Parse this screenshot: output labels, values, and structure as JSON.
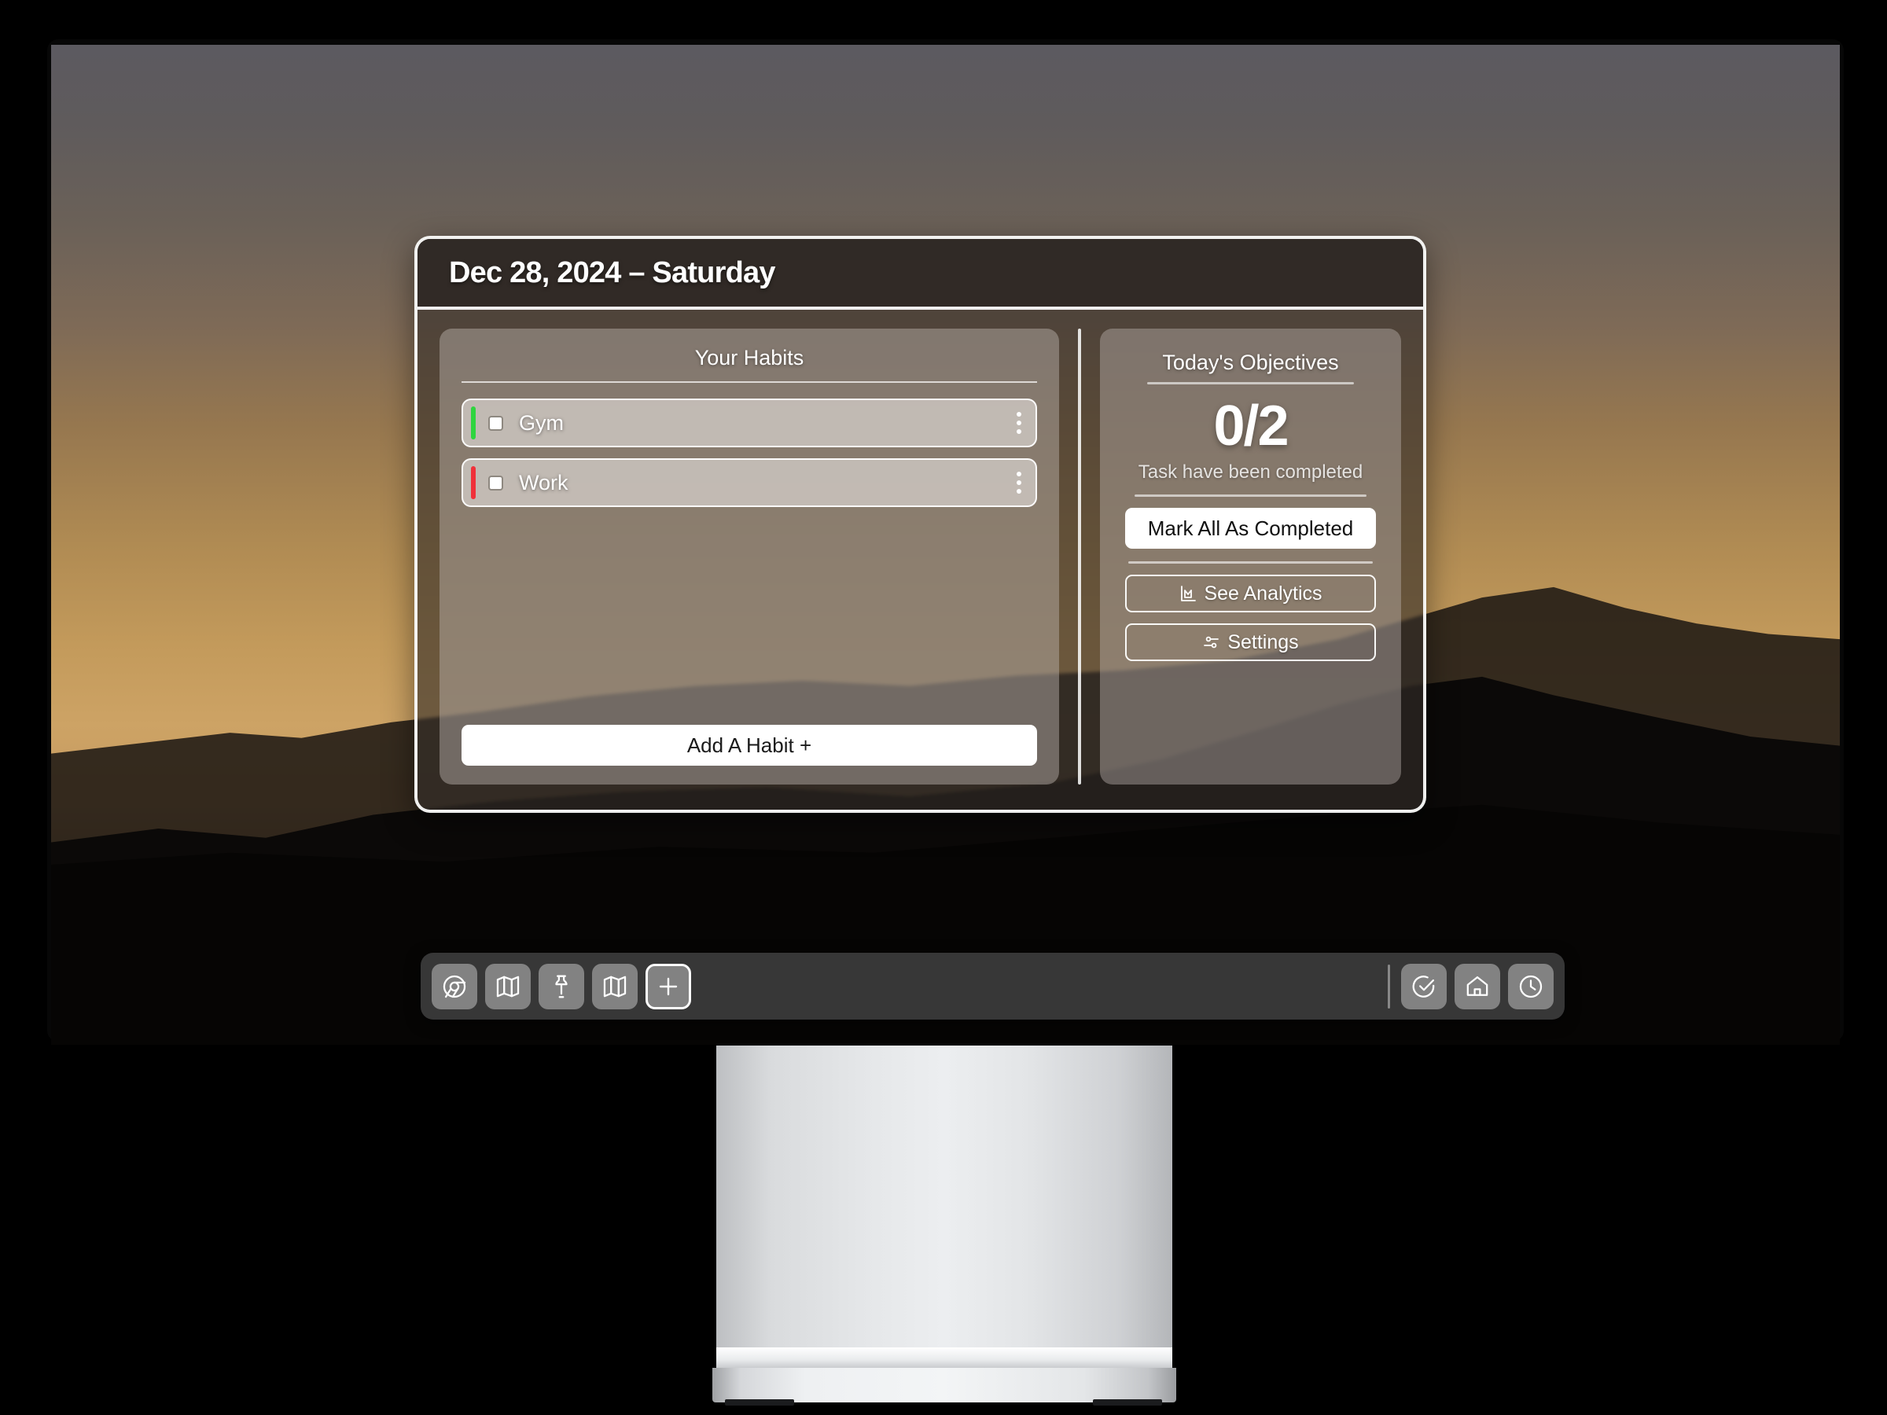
{
  "window": {
    "title": "Dec 28, 2024 – Saturday"
  },
  "habits_panel": {
    "heading": "Your Habits",
    "items": [
      {
        "name": "Gym",
        "accent_color": "#2fd53f",
        "checked": false,
        "menu_icon": "kebab-menu-icon"
      },
      {
        "name": "Work",
        "accent_color": "#f0313a",
        "checked": false,
        "menu_icon": "kebab-menu-icon"
      }
    ],
    "add_button_label": "Add A Habit +"
  },
  "objectives_panel": {
    "heading": "Today's Objectives",
    "count": "0/2",
    "completed_done": 0,
    "completed_total": 2,
    "subtitle": "Task have been completed",
    "mark_all_label": "Mark All As Completed",
    "analytics_label": "See Analytics",
    "analytics_icon": "chart-icon",
    "settings_label": "Settings",
    "settings_icon": "sliders-icon"
  },
  "dock": {
    "left_items": [
      {
        "icon": "chrome-icon",
        "label": "Chrome",
        "outlined": false
      },
      {
        "icon": "map-icon",
        "label": "Maps",
        "outlined": false
      },
      {
        "icon": "pin-icon",
        "label": "Pin",
        "outlined": false
      },
      {
        "icon": "map-icon",
        "label": "Maps",
        "outlined": false
      },
      {
        "icon": "plus-icon",
        "label": "Add",
        "outlined": true
      }
    ],
    "right_items": [
      {
        "icon": "check-circle-icon",
        "label": "Tasks"
      },
      {
        "icon": "home-icon",
        "label": "Home"
      },
      {
        "icon": "clock-icon",
        "label": "Clock"
      }
    ]
  },
  "colors": {
    "window_border": "#ffffff",
    "title_bar_bg": "#2f2824",
    "accent_white": "#ffffff",
    "habit_green": "#2fd53f",
    "habit_red": "#f0313a",
    "dock_bg": "#3a3a3a"
  }
}
